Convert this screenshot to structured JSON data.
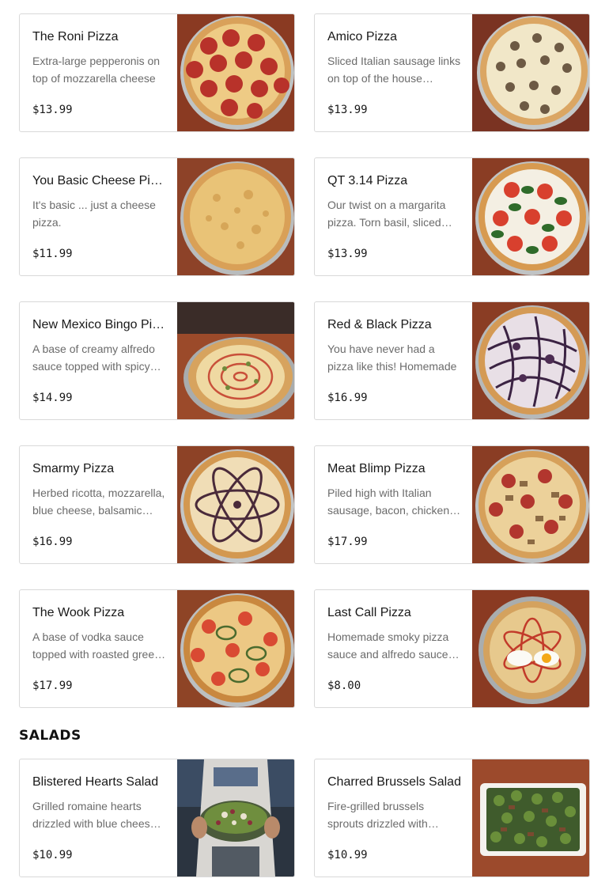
{
  "pizzas": [
    {
      "name": "The Roni Pizza",
      "description": "Extra-large pepperonis on top of mozzarella cheese",
      "price": "$13.99"
    },
    {
      "name": "Amico Pizza",
      "description": "Sliced Italian sausage links on top of the house mozzarella",
      "price": "$13.99"
    },
    {
      "name": "You Basic Cheese Pizza",
      "description": "It's basic ... just a cheese pizza.",
      "price": "$11.99"
    },
    {
      "name": "QT 3.14 Pizza",
      "description": "Our twist on a margarita pizza. Torn basil, sliced tomatoes",
      "price": "$13.99"
    },
    {
      "name": "New Mexico Bingo Pizza",
      "description": "A base of creamy alfredo sauce topped with spicy green chile",
      "price": "$14.99"
    },
    {
      "name": "Red & Black Pizza",
      "description": "You have never had a pizza like this! Homemade",
      "price": "$16.99"
    },
    {
      "name": "Smarmy Pizza",
      "description": "Herbed ricotta, mozzarella, blue cheese, balsamic drizzle",
      "price": "$16.99"
    },
    {
      "name": "Meat Blimp Pizza",
      "description": "Piled high with Italian sausage, bacon, chicken and pepperoni",
      "price": "$17.99"
    },
    {
      "name": "The Wook Pizza",
      "description": "A base of vodka sauce topped with roasted green chile",
      "price": "$17.99"
    },
    {
      "name": "Last Call Pizza",
      "description": "Homemade smoky pizza sauce and alfredo sauce with an egg",
      "price": "$8.00"
    }
  ],
  "salads_section": {
    "title": "SALADS"
  },
  "salads": [
    {
      "name": "Blistered Hearts Salad",
      "description": "Grilled romaine hearts drizzled with blue cheese dressing",
      "price": "$10.99"
    },
    {
      "name": "Charred Brussels Salad",
      "description": "Fire-grilled brussels sprouts drizzled with balsamic",
      "price": "$10.99"
    }
  ]
}
